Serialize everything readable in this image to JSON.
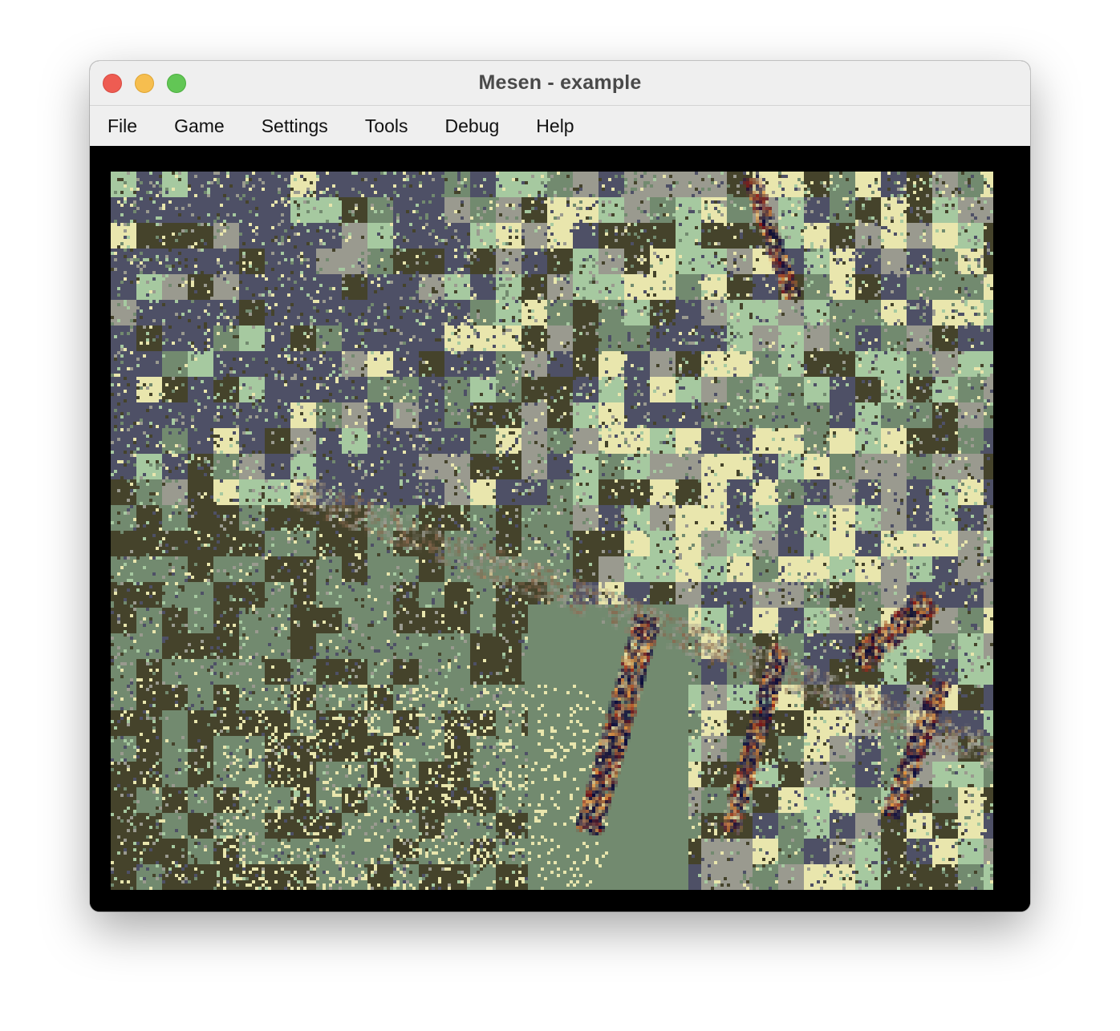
{
  "window": {
    "title": "Mesen - example"
  },
  "menu": {
    "items": [
      "File",
      "Game",
      "Settings",
      "Tools",
      "Debug",
      "Help"
    ]
  },
  "game_screen": {
    "description_colors": {
      "green_base": "#728a6f",
      "dark_olive": "#45432b",
      "slate": "#4e5066",
      "light_green": "#a6c9a0",
      "pale_yellow": "#e9e6ad",
      "navy": "#0c0c3c",
      "orange": "#e0913f",
      "dark_red": "#8a1a16",
      "gray": "#9a9a8f"
    }
  },
  "colors": {
    "titlebar_bg": "#efefef",
    "close": "#ee5c52",
    "minimize": "#f6be4f",
    "zoom": "#62c655",
    "content_bg": "#000000"
  }
}
